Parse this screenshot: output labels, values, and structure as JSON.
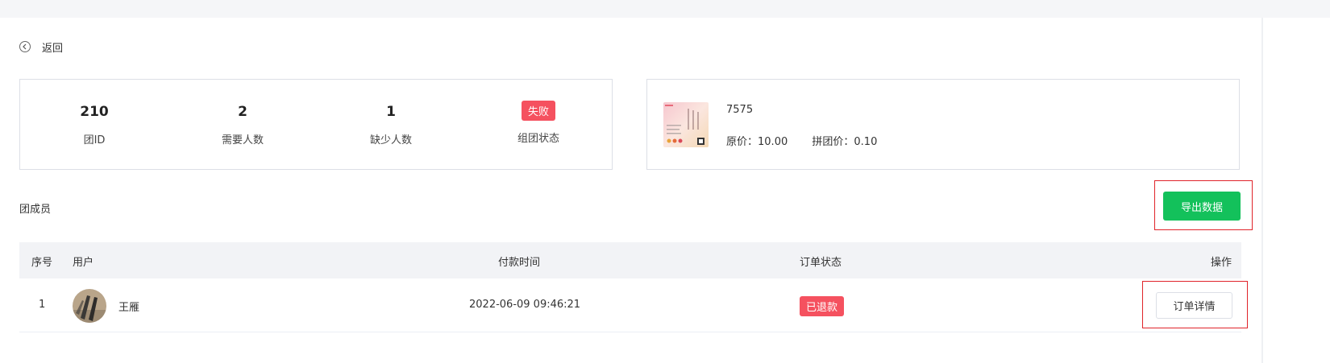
{
  "back": {
    "label": "返回"
  },
  "stats": [
    {
      "value": "210",
      "label": "团ID"
    },
    {
      "value": "2",
      "label": "需要人数"
    },
    {
      "value": "1",
      "label": "缺少人数"
    },
    {
      "badge": "失败",
      "label": "组团状态"
    }
  ],
  "product": {
    "name": "7575",
    "original_price_label": "原价：",
    "original_price": "10.00",
    "group_price_label": "拼团价：",
    "group_price": "0.10"
  },
  "section_title": "团成员",
  "export_button": "导出数据",
  "table": {
    "headers": {
      "index": "序号",
      "user": "用户",
      "pay_time": "付款时间",
      "order_status": "订单状态",
      "action": "操作"
    },
    "rows": [
      {
        "index": "1",
        "user": "王雁",
        "pay_time": "2022-06-09 09:46:21",
        "order_status": "已退款",
        "action": "订单详情"
      }
    ]
  },
  "colors": {
    "accent_green": "#13c15b",
    "status_red": "#f5515f",
    "highlight_red": "#e0242a"
  }
}
